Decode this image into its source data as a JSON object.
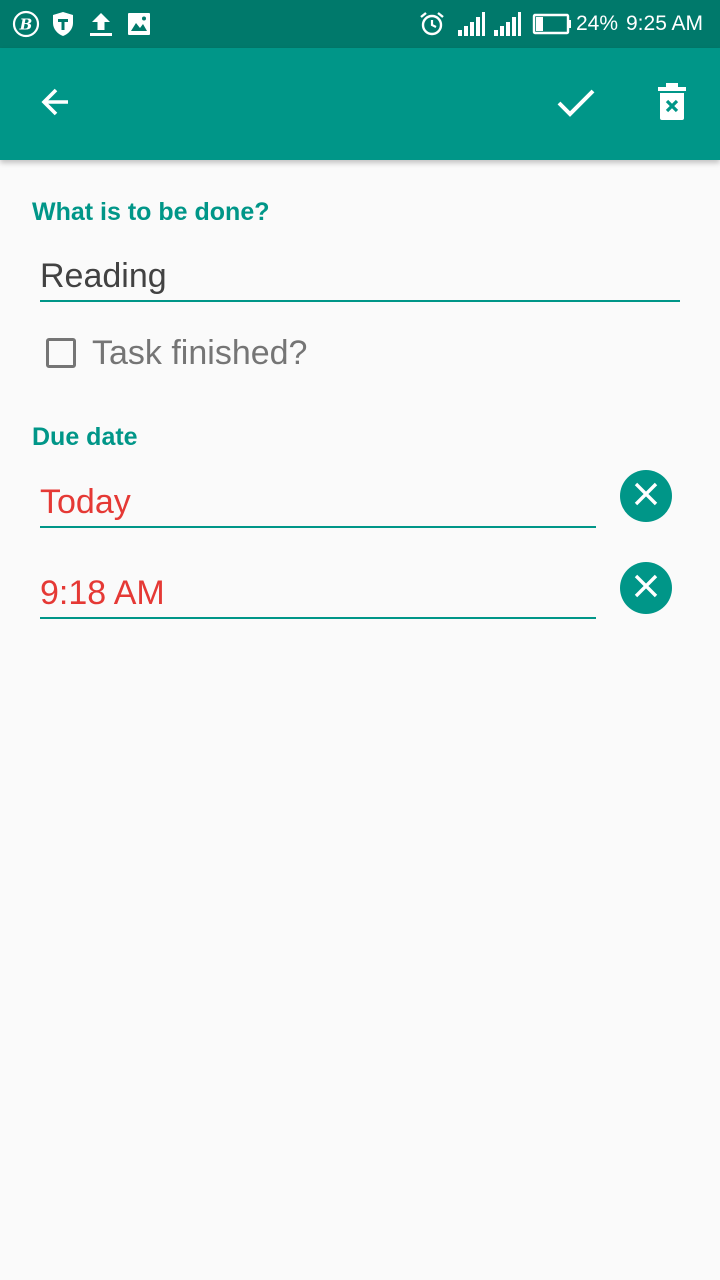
{
  "status_bar": {
    "battery_percent": "24%",
    "time": "9:25 AM",
    "left_icons": [
      "b-app-icon",
      "shield-icon",
      "upload-icon",
      "image-icon"
    ],
    "right_icons": [
      "alarm-icon",
      "signal-icon",
      "signal-icon",
      "battery-icon"
    ]
  },
  "toolbar": {
    "back_icon": "arrow-back-icon",
    "confirm_icon": "check-icon",
    "delete_icon": "delete-icon"
  },
  "form": {
    "task_label": "What is to be done?",
    "task_value": "Reading",
    "finished_label": "Task finished?",
    "finished_checked": false,
    "due_label": "Due date",
    "due_date_value": "Today",
    "due_time_value": "9:18 AM"
  },
  "colors": {
    "primary": "#009688",
    "primary_dark": "#00796b",
    "overdue_red": "#e53935",
    "text_dark": "#424242",
    "text_grey": "#757575"
  }
}
